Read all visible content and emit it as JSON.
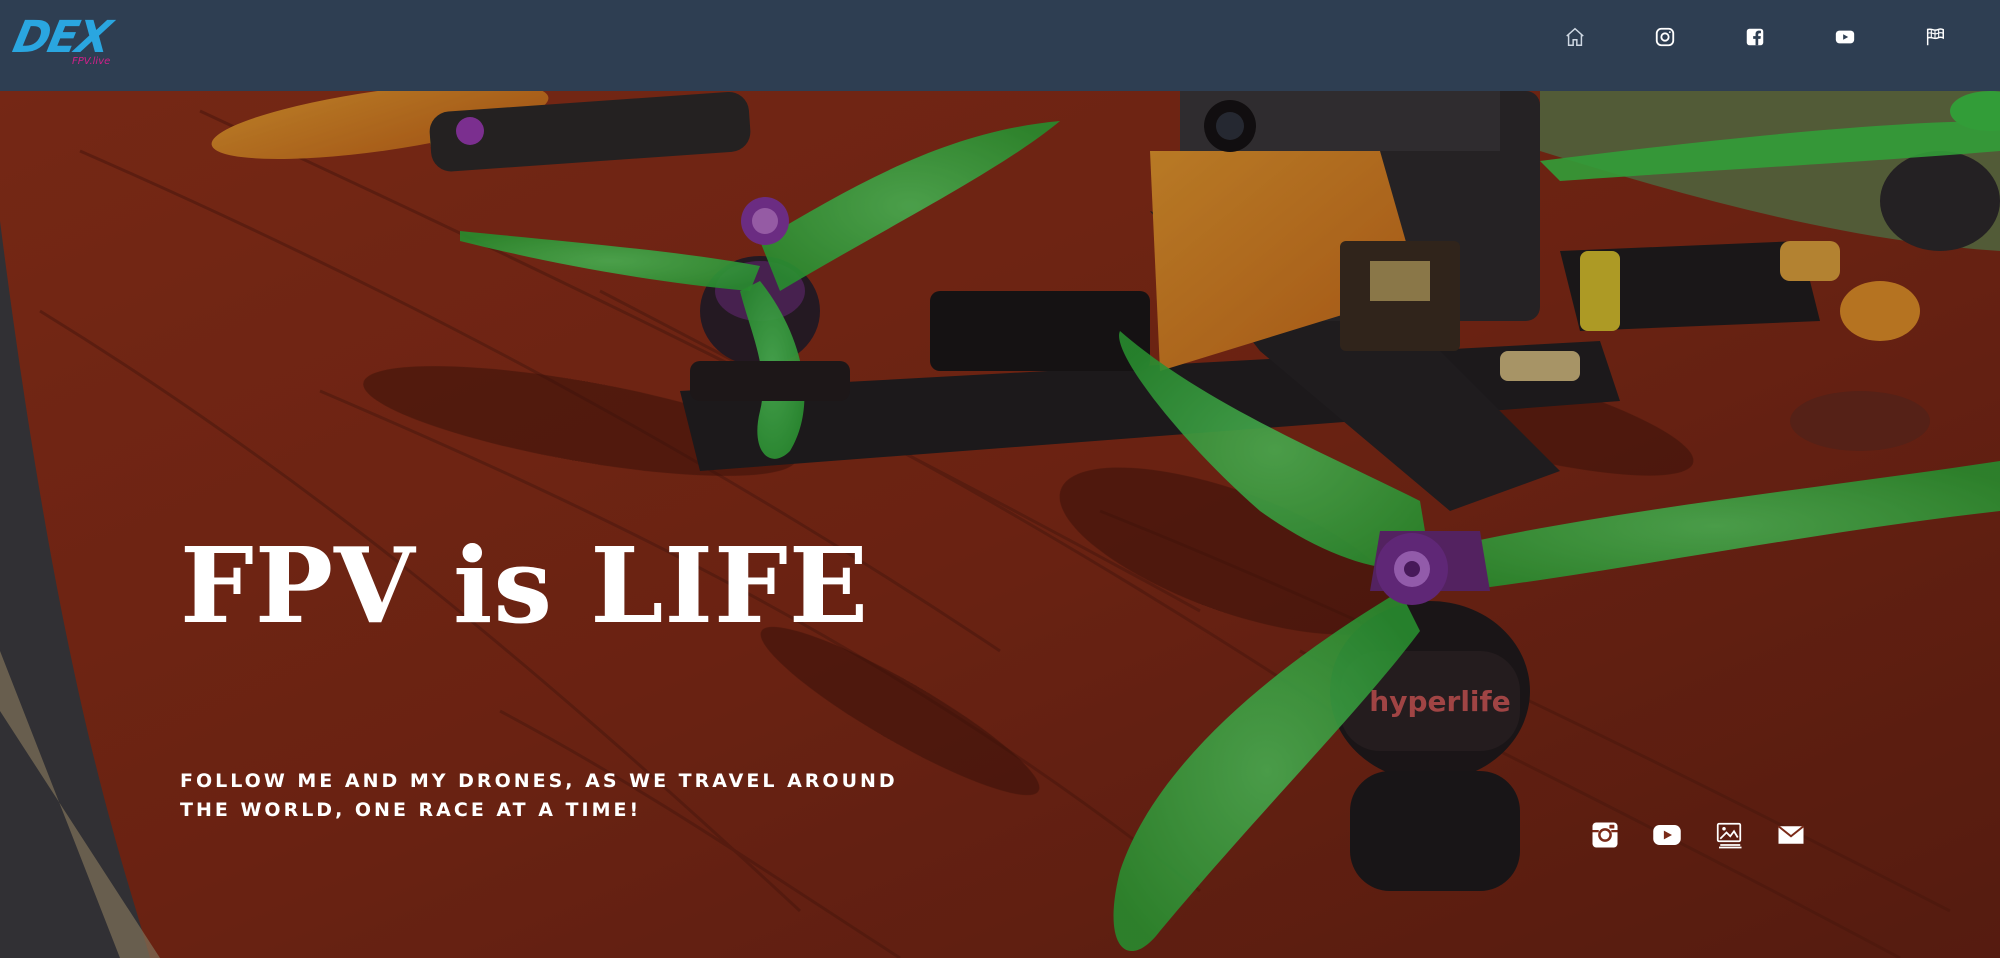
{
  "header": {
    "logo": {
      "main": "DEX",
      "sub": "FPV.live"
    },
    "nav": [
      {
        "name": "home",
        "icon": "home-icon"
      },
      {
        "name": "instagram",
        "icon": "instagram-icon"
      },
      {
        "name": "facebook",
        "icon": "facebook-icon"
      },
      {
        "name": "youtube",
        "icon": "youtube-icon"
      },
      {
        "name": "race",
        "icon": "race-flag-icon"
      }
    ]
  },
  "hero": {
    "headline": "FPV is LIFE",
    "tagline": "FOLLOW ME AND MY DRONES, AS WE TRAVEL AROUND THE WORLD, ONE RACE AT A TIME!",
    "social": [
      {
        "name": "instagram",
        "icon": "instagram-icon"
      },
      {
        "name": "youtube",
        "icon": "youtube-icon"
      },
      {
        "name": "gallery",
        "icon": "gallery-icon"
      },
      {
        "name": "email",
        "icon": "mail-icon"
      }
    ]
  },
  "colors": {
    "topbar": "#2e3e52",
    "logo_blue": "#2aa6e0",
    "logo_pink": "#d0208a",
    "bench_red": "#8a2a16",
    "prop_green": "#3ed64a",
    "text": "#ffffff"
  }
}
